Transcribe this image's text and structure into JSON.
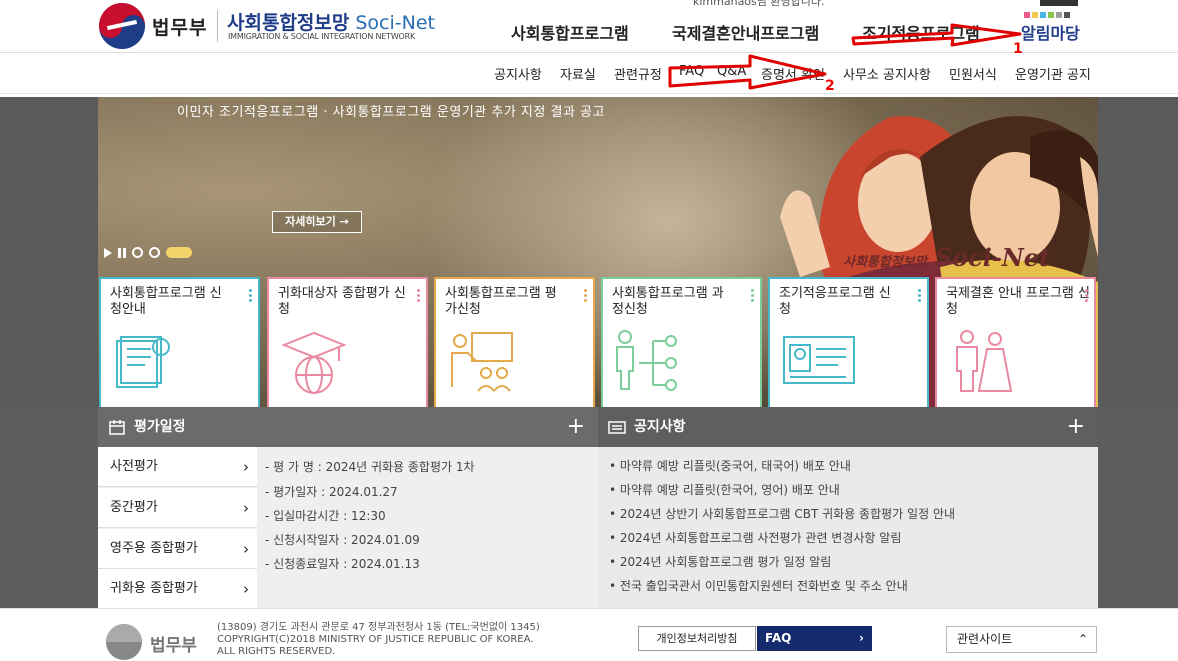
{
  "header": {
    "top_user_text": "kimmanaos님 환영합니다.",
    "ministry": "법무부",
    "site_name_ko": "사회통합정보망",
    "site_name_en": "Soci-Net",
    "site_subtitle": "IMMIGRATION & SOCIAL INTEGRATION NETWORK",
    "gnb": [
      "사회통합프로그램",
      "국제결혼안내프로그램",
      "조기적응프로그램",
      "알림마당"
    ],
    "snb": [
      "공지사항",
      "자료실",
      "관련규정",
      "FAQ",
      "Q&A",
      "증명서 확인",
      "사무소 공지사항",
      "민원서식",
      "운영기관 공지"
    ],
    "color_dots": [
      "#e85a8a",
      "#f2c84b",
      "#4db3e6",
      "#8bc34a",
      "#9e9e9e",
      "#555555"
    ]
  },
  "hero": {
    "title": "이민자 조기적응프로그램 · 사회통합프로그램 운영기관 추가 지정 결과 공고",
    "more_label": "자세히보기 →",
    "brand_ko": "사회통합정보망",
    "brand_en": "Soci-Net"
  },
  "cards": [
    {
      "title": "사회통합프로그램 신청안내",
      "color": "#47b8c9",
      "icon": "application-guide-icon"
    },
    {
      "title": "귀화대상자 종합평가 신청",
      "color": "#e98aa0",
      "icon": "graduation-globe-icon"
    },
    {
      "title": "사회통합프로그램 평가신청",
      "color": "#e3a94a",
      "icon": "presentation-icon"
    },
    {
      "title": "사회통합프로그램 과정신청",
      "color": "#7ccf9a",
      "icon": "course-flow-icon"
    },
    {
      "title": "조기적응프로그램 신청",
      "color": "#47b8c9",
      "icon": "id-card-icon"
    },
    {
      "title": "국제결혼 안내 프로그램 신청",
      "color": "#e98aa0",
      "icon": "wedding-couple-icon"
    }
  ],
  "schedule": {
    "title": "평가일정",
    "tabs": [
      "사전평가",
      "중간평가",
      "영주용 종합평가",
      "귀화용 종합평가"
    ],
    "lines": [
      "- 평 가 명 : 2024년 귀화용 종합평가 1차",
      "- 평가일자 : 2024.01.27",
      "- 입실마감시간 : 12:30",
      "- 신청시작일자 : 2024.01.09",
      "- 신청종료일자 : 2024.01.13"
    ]
  },
  "notice": {
    "title": "공지사항",
    "items": [
      "마약류 예방 리플릿(중국어, 태국어) 배포 안내",
      "마약류 예방 리플릿(한국어, 영어) 배포 안내",
      "2024년 상반기 사회통합프로그램 CBT 귀화용 종합평가 일정 안내",
      "2024년 사회통합프로그램 사전평가 관련 변경사항 알림",
      "2024년 사회통합프로그램 평가 일정 알림",
      "전국 출입국관서 이민통합지원센터 전화번호 및 주소 안내"
    ]
  },
  "footer": {
    "ministry": "법무부",
    "address": "(13809) 경기도 과천시 관문로 47 정부과천청사 1동 (TEL:국번없이 1345)",
    "copyright1": "COPYRIGHT(C)2018 MINISTRY OF JUSTICE REPUBLIC OF KOREA.",
    "copyright2": "ALL RIGHTS RESERVED.",
    "privacy": "개인정보처리방침",
    "faq": "FAQ",
    "related": "관련사이트"
  },
  "annotations": {
    "n1": "1",
    "n2": "2",
    "color": "#e00000"
  }
}
